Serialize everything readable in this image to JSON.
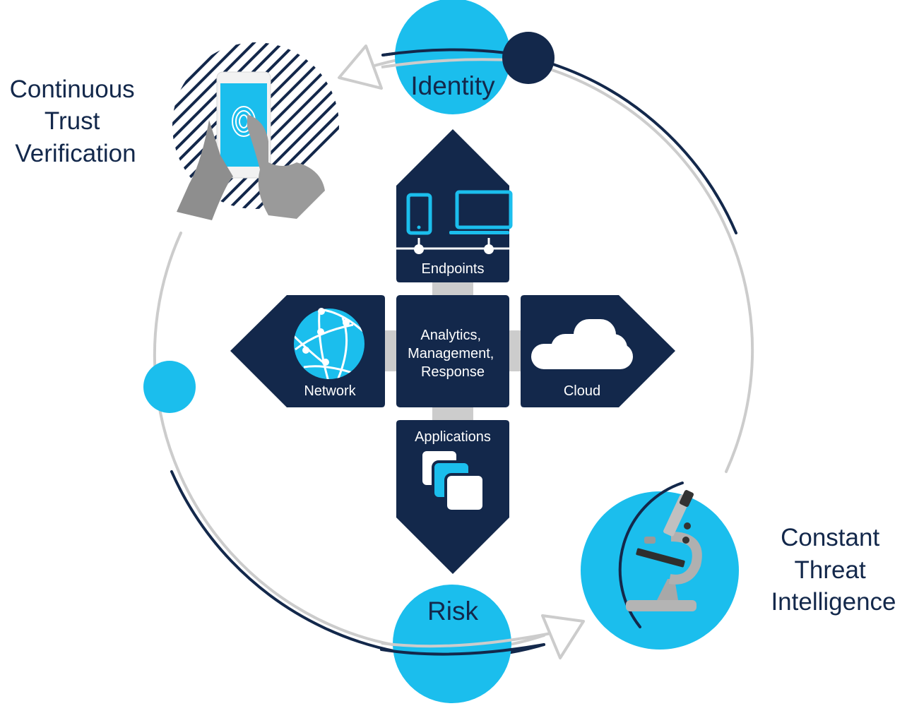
{
  "colors": {
    "navy": "#13284b",
    "cyan": "#1bbeed",
    "gray": "#cccccc",
    "white": "#ffffff"
  },
  "side_labels": {
    "left": [
      "Continuous",
      "Trust",
      "Verification"
    ],
    "right": [
      "Constant",
      "Threat",
      "Intelligence"
    ]
  },
  "orbit_nodes": {
    "identity": "Identity",
    "risk": "Risk"
  },
  "center": {
    "lines": [
      "Analytics,",
      "Management,",
      "Response"
    ]
  },
  "pillars": {
    "endpoints": "Endpoints",
    "network": "Network",
    "cloud": "Cloud",
    "applications": "Applications"
  },
  "images": {
    "fingerprint_phone": "hands holding phone with fingerprint scan",
    "microscope": "microscope"
  },
  "icons": {
    "endpoints": [
      "phone-icon",
      "laptop-icon"
    ],
    "network": "globe-network-icon",
    "cloud": "cloud-icon",
    "applications": "stacked-apps-icon"
  }
}
